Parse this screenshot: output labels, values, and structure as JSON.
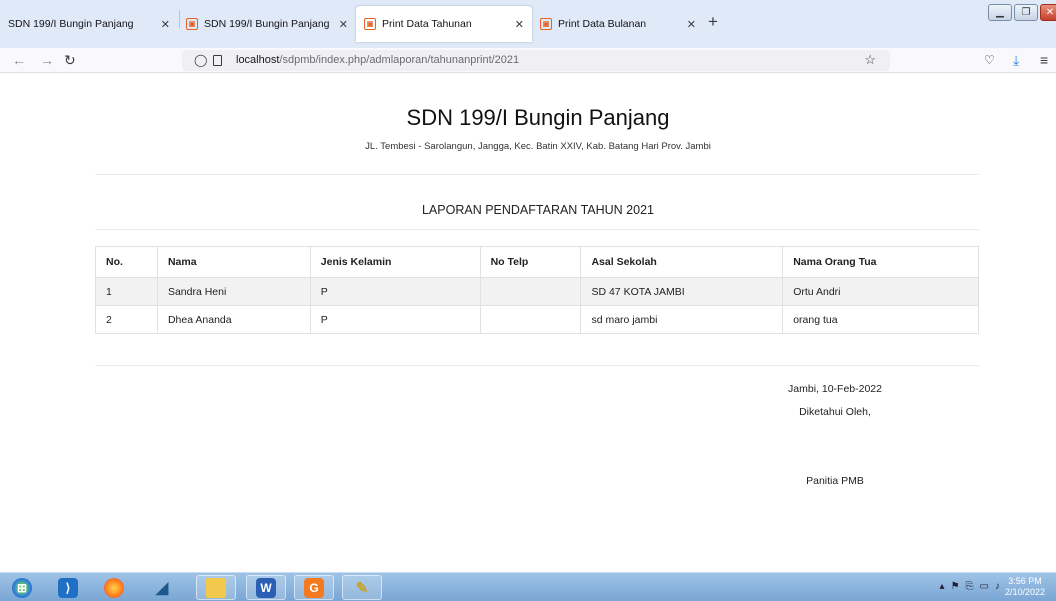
{
  "browser": {
    "tabs": [
      {
        "label": "SDN 199/I Bungin Panjang",
        "active": false,
        "has_icon": false
      },
      {
        "label": "SDN 199/I Bungin Panjang",
        "active": false,
        "has_icon": true
      },
      {
        "label": "Print Data Tahunan",
        "active": true,
        "has_icon": true
      },
      {
        "label": "Print Data Bulanan",
        "active": false,
        "has_icon": true
      }
    ],
    "new_tab_icon": "plus-icon",
    "url_host": "localhost",
    "url_path": "/sdpmb/index.php/admlaporan/tahunanprint/2021"
  },
  "header": {
    "school_name": "SDN 199/I Bungin Panjang",
    "address": "JL. Tembesi - Sarolangun, Jangga, Kec. Batin XXIV, Kab. Batang Hari Prov. Jambi"
  },
  "report": {
    "title": "LAPORAN PENDAFTARAN TAHUN 2021",
    "columns": [
      "No.",
      "Nama",
      "Jenis Kelamin",
      "No Telp",
      "Asal Sekolah",
      "Nama Orang Tua"
    ],
    "rows": [
      [
        "1",
        "Sandra Heni",
        "P",
        "",
        "SD 47 KOTA JAMBI",
        "Ortu Andri"
      ],
      [
        "2",
        "Dhea Ananda",
        "P",
        "",
        "sd maro jambi",
        "orang tua"
      ]
    ]
  },
  "signature": {
    "place_date": "Jambi, 10-Feb-2022",
    "known_by": "Diketahui Oleh,",
    "signer": "Panitia PMB"
  },
  "taskbar": {
    "clock_time": "3:56 PM",
    "clock_date": "2/10/2022"
  },
  "colors": {
    "tab_icon": "#e8612a",
    "taskbar": "#7aa6d4",
    "row_stripe": "#f2f2f2"
  }
}
